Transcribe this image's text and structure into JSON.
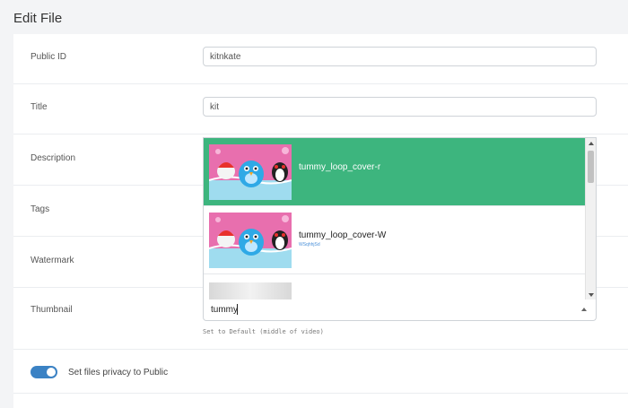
{
  "page": {
    "title": "Edit File"
  },
  "form": {
    "public_id": {
      "label": "Public ID",
      "value": "kitnkate"
    },
    "title": {
      "label": "Title",
      "value": "kit"
    },
    "description": {
      "label": "Description"
    },
    "tags": {
      "label": "Tags"
    },
    "watermark": {
      "label": "Watermark"
    },
    "thumbnail": {
      "label": "Thumbnail",
      "search_value": "tummy",
      "helper": "Set to Default (middle of video)",
      "options": [
        {
          "name": "tummy_loop_cover-r",
          "id": "",
          "selected": true
        },
        {
          "name": "tummy_loop_cover-W",
          "id": "WSqhhjSd",
          "selected": false
        }
      ]
    },
    "privacy_toggle": {
      "label": "Set files privacy to Public",
      "on": true
    }
  },
  "colors": {
    "selected": "#3db57e",
    "toggle": "#3b82c4"
  },
  "icons": [
    "chevron-up-icon",
    "scroll-up-icon",
    "scroll-down-icon"
  ]
}
